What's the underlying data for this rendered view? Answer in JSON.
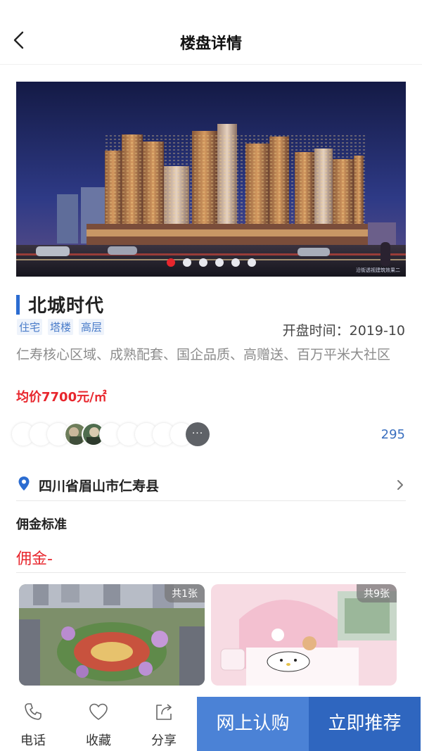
{
  "header": {
    "title": "楼盘详情"
  },
  "banner": {
    "slide_count": 6,
    "active_index": 0,
    "caption": "沿街透视建筑效果二"
  },
  "property": {
    "name": "北城时代",
    "tags": [
      "住宅",
      "塔楼",
      "高层"
    ],
    "open_time": "开盘时间：2019-10",
    "description": "仁寿核心区域、成熟配套、国企品质、高赠送、百万平米大社区",
    "price": "均价7700元/㎡"
  },
  "viewers": {
    "count": "295",
    "more_label": "···"
  },
  "address": {
    "text": "四川省眉山市仁寿县"
  },
  "commission": {
    "title": "佣金标准",
    "value": "佣金-"
  },
  "albums": [
    {
      "count_label": "共1张"
    },
    {
      "count_label": "共9张"
    }
  ],
  "bottom_bar": {
    "phone_label": "电话",
    "favorite_label": "收藏",
    "share_label": "分享",
    "buy_label": "网上认购",
    "recommend_label": "立即推荐"
  },
  "colors": {
    "accent_blue": "#2b6cd1",
    "price_red": "#e8262d",
    "buy_button": "#4b82d6",
    "recommend_button": "#2f66bf"
  }
}
